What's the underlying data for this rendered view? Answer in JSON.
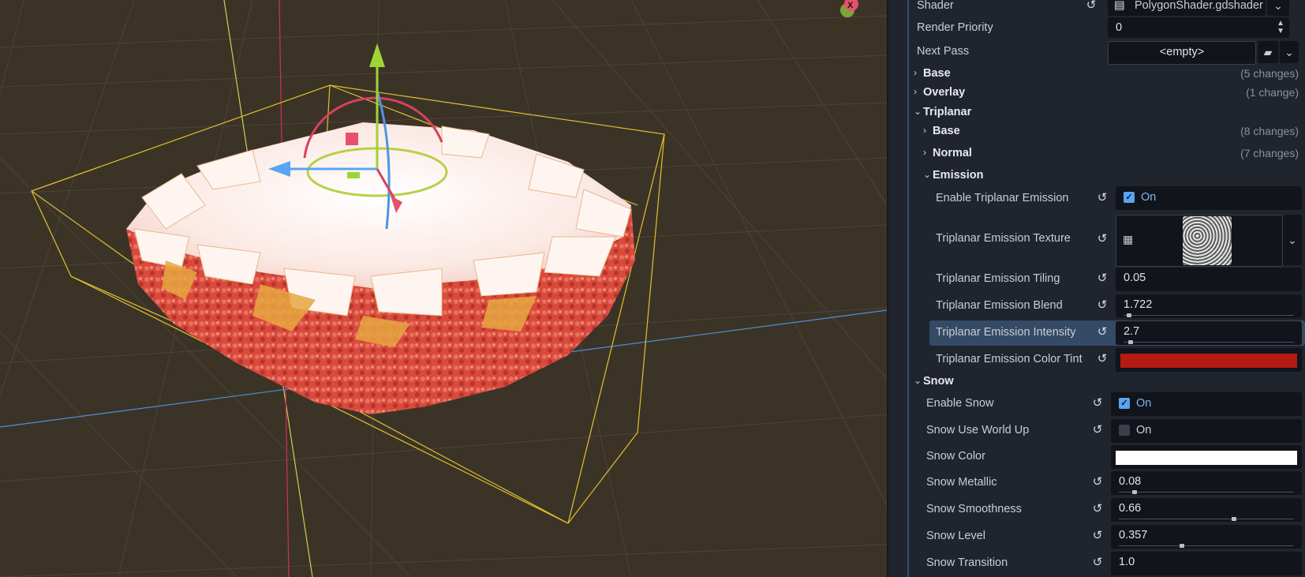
{
  "viewport": {
    "gizmo_x_label": "X"
  },
  "inspector": {
    "shader": {
      "label": "Shader",
      "value": "PolygonShader.gdshader"
    },
    "render_priority": {
      "label": "Render Priority",
      "value": "0"
    },
    "next_pass": {
      "label": "Next Pass",
      "value": "<empty>"
    },
    "sections": {
      "base": {
        "title": "Base",
        "changes": "(5 changes)"
      },
      "overlay": {
        "title": "Overlay",
        "changes": "(1 change)"
      },
      "triplanar": {
        "title": "Triplanar"
      },
      "tri_base": {
        "title": "Base",
        "changes": "(8 changes)"
      },
      "tri_normal": {
        "title": "Normal",
        "changes": "(7 changes)"
      },
      "tri_emission": {
        "title": "Emission"
      },
      "snow": {
        "title": "Snow"
      }
    },
    "emission": {
      "enable": {
        "label": "Enable Triplanar Emission",
        "value": "On",
        "checked": true
      },
      "texture": {
        "label": "Triplanar Emission Texture"
      },
      "tiling": {
        "label": "Triplanar Emission Tiling",
        "value": "0.05"
      },
      "blend": {
        "label": "Triplanar Emission Blend",
        "value": "1.722",
        "fraction": 0.02
      },
      "intensity": {
        "label": "Triplanar Emission Intensity",
        "value": "2.7",
        "fraction": 0.03
      },
      "color_tint": {
        "label": "Triplanar Emission Color Tint",
        "color": "#b51a13"
      }
    },
    "snow": {
      "enable": {
        "label": "Enable Snow",
        "value": "On",
        "checked": true
      },
      "world_up": {
        "label": "Snow Use World Up",
        "value": "On",
        "checked": false
      },
      "color": {
        "label": "Snow Color",
        "color": "#ffffff"
      },
      "metallic": {
        "label": "Snow Metallic",
        "value": "0.08",
        "fraction": 0.08
      },
      "smoothness": {
        "label": "Snow Smoothness",
        "value": "0.66",
        "fraction": 0.66
      },
      "level": {
        "label": "Snow Level",
        "value": "0.357",
        "fraction": 0.357
      },
      "transition": {
        "label": "Snow Transition",
        "value": "1.0"
      }
    }
  },
  "colors": {
    "accent": "#5aa4f2",
    "viewport_bg": "#3c3327",
    "panel_bg": "#20242d"
  }
}
